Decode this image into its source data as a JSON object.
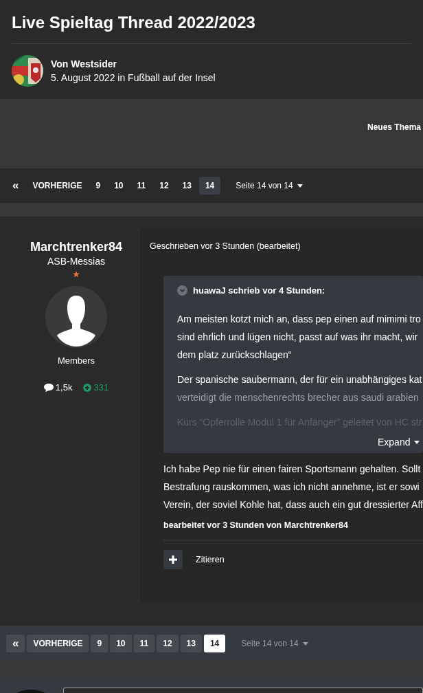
{
  "topic": {
    "title": "Live Spieltag Thread 2022/2023",
    "author": "Von Westsider",
    "meta": "5. August 2022 in Fußball auf der Insel"
  },
  "actions": {
    "new_topic": "Neues Thema"
  },
  "pager_top": {
    "items": [
      {
        "label": "«",
        "kind": "first",
        "selected": false
      },
      {
        "label": "VORHERIGE",
        "kind": "prev",
        "selected": false
      },
      {
        "label": "9",
        "kind": "page",
        "selected": false
      },
      {
        "label": "10",
        "kind": "page",
        "selected": false
      },
      {
        "label": "11",
        "kind": "page",
        "selected": false
      },
      {
        "label": "12",
        "kind": "page",
        "selected": false
      },
      {
        "label": "13",
        "kind": "page",
        "selected": false
      },
      {
        "label": "14",
        "kind": "page",
        "selected": true
      }
    ],
    "jump": "Seite 14 von 14"
  },
  "post": {
    "author": {
      "name": "Marchtrenker84",
      "rank": "ASB-Messias",
      "group": "Members",
      "posts": "1,5k",
      "reputation": "331"
    },
    "written": "Geschrieben vor 3 Stunden (bearbeitet)",
    "quote": {
      "header": "huawaJ schrieb vor 4 Stunden:",
      "expand": "Expand",
      "paragraphs": [
        {
          "lines": [
            {
              "text": "Am meisten kotzt mich an, dass pep einen auf mimimi tro",
              "kind": "normal"
            },
            {
              "text": "sind ehrlich und lügen nicht, passt auf was ihr macht, wir",
              "kind": "normal"
            },
            {
              "text": "dem platz zurückschlagen“",
              "kind": "normal"
            }
          ]
        },
        {
          "lines": [
            {
              "text": "Der spanische saubermann, der für ein unabhängiges kat",
              "kind": "normal"
            },
            {
              "text": "verteidigt die menschenrechts brecher aus saudi arabien",
              "kind": "fading"
            }
          ]
        },
        {
          "lines": [
            {
              "text": "Kurs “Opferrolle Modul 1 für Anfänger” geleitet von HC str",
              "kind": "faded"
            }
          ]
        }
      ]
    },
    "body": [
      "Ich habe Pep nie für einen fairen Sportsmann gehalten. Sollt",
      "Bestrafung rauskommen, was ich nicht annehme, ist er sowi",
      "Verein, der soviel Kohle hat, dass auch ein gut dressierter Aff"
    ],
    "edited": "bearbeitet vor 3 Stunden von Marchtrenker84",
    "quote_button": "Zitieren"
  },
  "pager_bottom": {
    "items": [
      {
        "label": "«",
        "kind": "first",
        "selected": false
      },
      {
        "label": "VORHERIGE",
        "kind": "prev",
        "selected": false
      },
      {
        "label": "9",
        "kind": "page",
        "selected": false
      },
      {
        "label": "10",
        "kind": "page",
        "selected": false
      },
      {
        "label": "11",
        "kind": "page",
        "selected": false
      },
      {
        "label": "12",
        "kind": "page",
        "selected": false
      },
      {
        "label": "13",
        "kind": "page",
        "selected": false
      },
      {
        "label": "14",
        "kind": "page",
        "selected": true
      }
    ],
    "jump": "Seite 14 von 14"
  }
}
